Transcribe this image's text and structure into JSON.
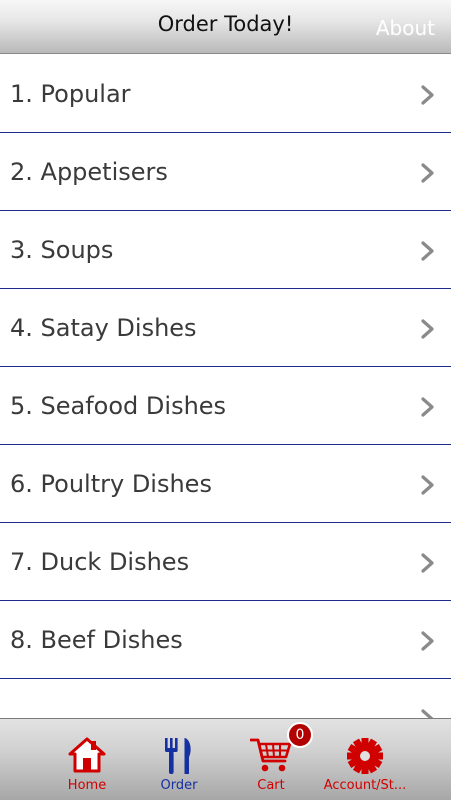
{
  "header": {
    "title": "Order Today!",
    "about_label": "About"
  },
  "menu": {
    "items": [
      {
        "label": "1. Popular"
      },
      {
        "label": "2. Appetisers"
      },
      {
        "label": "3. Soups"
      },
      {
        "label": "4. Satay Dishes"
      },
      {
        "label": "5. Seafood Dishes"
      },
      {
        "label": "6. Poultry Dishes"
      },
      {
        "label": "7. Duck Dishes"
      },
      {
        "label": "8. Beef Dishes"
      },
      {
        "label": ""
      }
    ]
  },
  "tabbar": {
    "tabs": [
      {
        "label": "Home",
        "icon": "home-icon",
        "color": "#d00000"
      },
      {
        "label": "Order",
        "icon": "fork-knife-icon",
        "color": "#1530a0"
      },
      {
        "label": "Cart",
        "icon": "cart-icon",
        "color": "#d00000"
      },
      {
        "label": "Account/St...",
        "icon": "gear-icon",
        "color": "#d00000"
      }
    ],
    "cart_count": "0"
  },
  "colors": {
    "accent_red": "#d00000",
    "accent_blue": "#1530a0",
    "divider": "#1e2a8c"
  }
}
